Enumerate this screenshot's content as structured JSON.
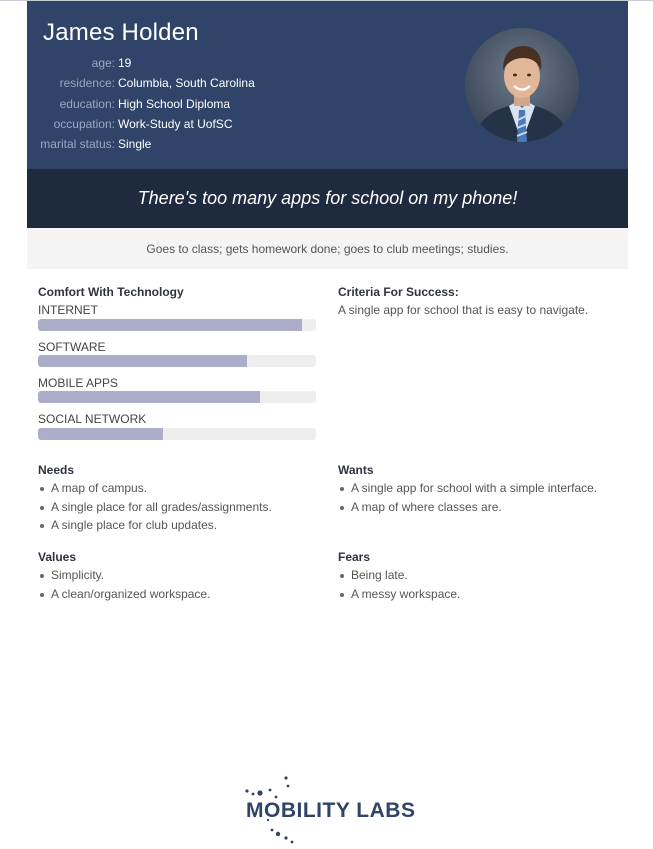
{
  "persona": {
    "name": "James Holden",
    "details": [
      {
        "label": "age:",
        "value": "19"
      },
      {
        "label": "residence:",
        "value": "Columbia, South Carolina"
      },
      {
        "label": "education:",
        "value": "High School Diploma"
      },
      {
        "label": "occupation:",
        "value": "Work-Study at UofSC"
      },
      {
        "label": "marital status:",
        "value": "Single"
      }
    ],
    "quote": "There's too many apps for school on my phone!",
    "summary": "Goes to class; gets homework done; goes to club meetings; studies."
  },
  "tech": {
    "title": "Comfort With Technology",
    "items": [
      {
        "label": "INTERNET",
        "level": 0.95
      },
      {
        "label": "SOFTWARE",
        "level": 0.75
      },
      {
        "label": "MOBILE APPS",
        "level": 0.8
      },
      {
        "label": "SOCIAL NETWORK",
        "level": 0.45
      }
    ]
  },
  "criteria": {
    "title": "Criteria For Success:",
    "text": "A single app for school that is easy to navigate."
  },
  "needs": {
    "title": "Needs",
    "items": [
      "A map of campus.",
      "A single place for all grades/assignments.",
      "A single place for club updates."
    ]
  },
  "wants": {
    "title": "Wants",
    "items": [
      "A single app for school with a simple interface.",
      "A map of where classes are."
    ]
  },
  "values": {
    "title": "Values",
    "items": [
      "Simplicity.",
      "A clean/organized workspace."
    ]
  },
  "fears": {
    "title": "Fears",
    "items": [
      "Being late.",
      "A messy workspace."
    ]
  },
  "logo": {
    "text": "MOBILITY LABS"
  },
  "colors": {
    "header_bg": "#2f4468",
    "quote_bg": "#1e2a3d",
    "bar_fill": "#acadc8",
    "bar_track": "#eeeeee"
  }
}
